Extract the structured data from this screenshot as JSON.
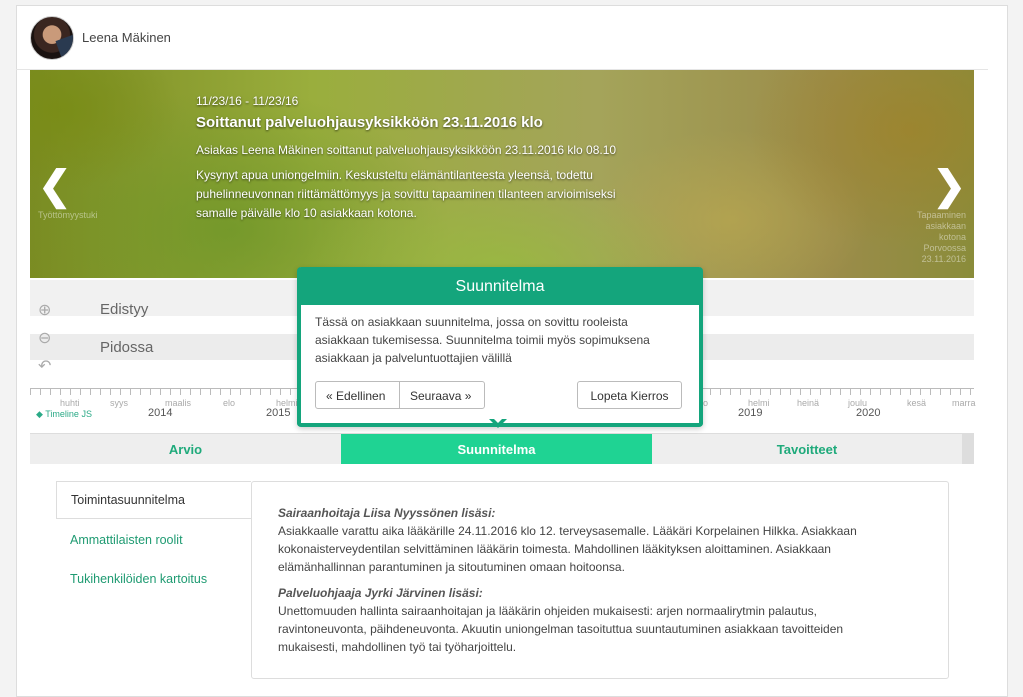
{
  "user": {
    "name": "Leena Mäkinen"
  },
  "slide": {
    "date": "11/23/16 - 11/23/16",
    "title": "Soittanut palveluohjausyksikköön 23.11.2016 klo",
    "paragraph1": "Asiakas Leena Mäkinen soittanut palveluohjausyksikköön 23.11.2016 klo 08.10",
    "paragraph2": "Kysynyt apua uniongelmiin. Keskusteltu elämäntilanteesta yleensä, todettu puhelinneuvonnan riittämättömyys ja sovittu tapaaminen tilanteen arvioimiseksi samalle päivälle klo 10 asiakkaan kotona.",
    "prev_caption": "Työttömyystuki",
    "next_caption": "Tapaaminen asiakkaan kotona Porvoossa 23.11.2016"
  },
  "timeline": {
    "rows": [
      "Edistyy",
      "Pidossa"
    ],
    "brand": "Timeline JS",
    "months": [
      "huhti",
      "syys",
      "maalis",
      "elo",
      "helmi",
      "elo",
      "helmi",
      "heinä",
      "joulu",
      "kesä",
      "marra"
    ],
    "years": [
      "2014",
      "2015",
      "2019",
      "2020"
    ]
  },
  "tabs": [
    "Arvio",
    "Suunnitelma",
    "Tavoitteet"
  ],
  "side_nav": [
    "Toimintasuunnitelma",
    "Ammattilaisten roolit",
    "Tukihenkilöiden kartoitus"
  ],
  "notes": [
    {
      "head": "Sairaanhoitaja Liisa Nyyssönen lisäsi:",
      "body": "Asiakkaalle varattu aika lääkärille 24.11.2016 klo 12. terveysasemalle. Lääkäri Korpelainen Hilkka. Asiakkaan kokonaisterveydentilan selvittäminen lääkärin toimesta. Mahdollinen lääkityksen aloittaminen. Asiakkaan elämänhallinnan parantuminen ja sitoutuminen omaan hoitoonsa."
    },
    {
      "head": "Palveluohjaaja Jyrki Järvinen lisäsi:",
      "body": "Unettomuuden hallinta sairaanhoitajan ja lääkärin ohjeiden mukaisesti: arjen normaalirytmin palautus, ravintoneuvonta, päihdeneuvonta. Akuutin uniongelman tasoituttua suuntautuminen asiakkaan tavoitteiden mukaisesti, mahdollinen työ tai työharjoittelu."
    }
  ],
  "tour": {
    "title": "Suunnitelma",
    "text": "Tässä on asiakkaan suunnitelma, jossa on sovittu rooleista asiakkaan tukemisessa. Suunnitelma toimii myös sopimuksena asiakkaan ja palveluntuottajien välillä",
    "prev": "« Edellinen",
    "next": "Seuraava »",
    "end": "Lopeta Kierros"
  },
  "colors": {
    "accent": "#14a57c",
    "tab_active": "#1fd393",
    "link": "#1f9b72"
  }
}
